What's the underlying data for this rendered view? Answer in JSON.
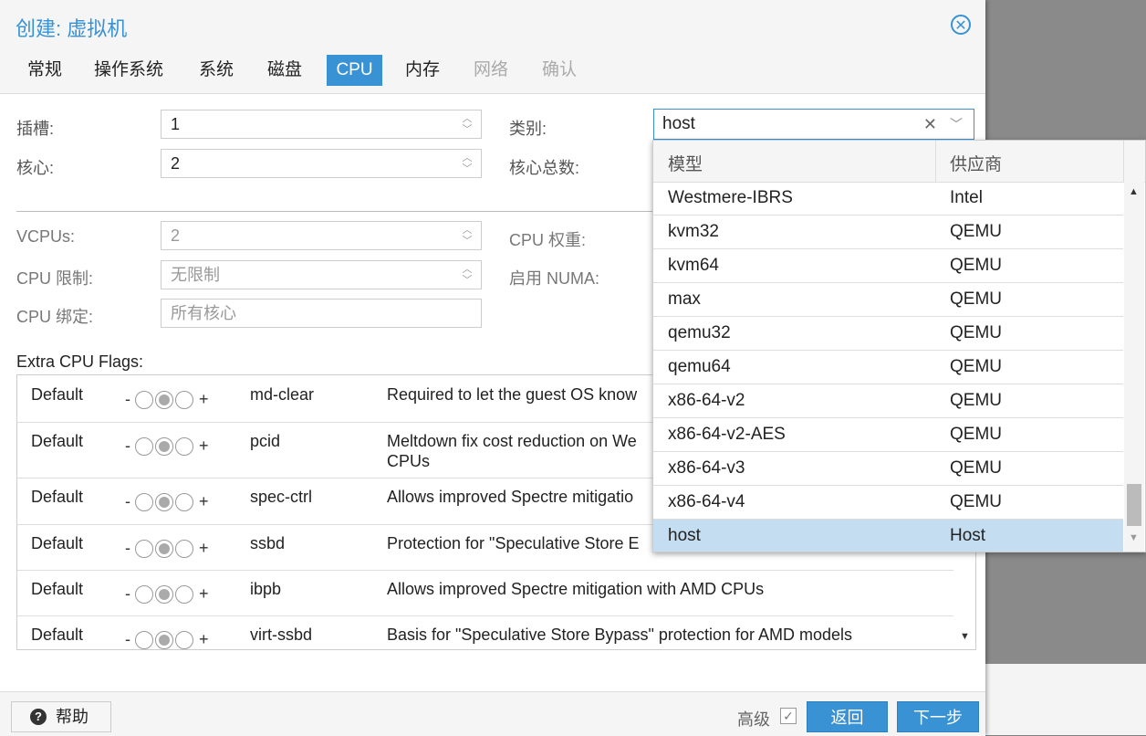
{
  "dialog": {
    "title": "创建: 虚拟机"
  },
  "tabs": [
    {
      "label": "常规",
      "state": "normal"
    },
    {
      "label": "操作系统",
      "state": "normal"
    },
    {
      "label": "系统",
      "state": "normal"
    },
    {
      "label": "磁盘",
      "state": "normal"
    },
    {
      "label": "CPU",
      "state": "active"
    },
    {
      "label": "内存",
      "state": "normal"
    },
    {
      "label": "网络",
      "state": "disabled"
    },
    {
      "label": "确认",
      "state": "disabled"
    }
  ],
  "form": {
    "sockets_label": "插槽:",
    "sockets_value": "1",
    "cores_label": "核心:",
    "cores_value": "2",
    "type_label": "类别:",
    "type_value": "host",
    "total_cores_label": "核心总数:",
    "vcpus_label": "VCPUs:",
    "vcpus_value": "2",
    "cpu_limit_label": "CPU 限制:",
    "cpu_limit_placeholder": "无限制",
    "cpu_affinity_label": "CPU 绑定:",
    "cpu_affinity_placeholder": "所有核心",
    "cpu_weight_label": "CPU 权重:",
    "numa_label": "启用 NUMA:"
  },
  "flags": {
    "label": "Extra CPU Flags:",
    "rows": [
      {
        "state": "Default",
        "name": "md-clear",
        "desc": "Required to let the guest OS know"
      },
      {
        "state": "Default",
        "name": "pcid",
        "desc": "Meltdown fix cost reduction on We",
        "desc2": "CPUs"
      },
      {
        "state": "Default",
        "name": "spec-ctrl",
        "desc": "Allows improved Spectre mitigatio"
      },
      {
        "state": "Default",
        "name": "ssbd",
        "desc": "Protection for \"Speculative Store E"
      },
      {
        "state": "Default",
        "name": "ibpb",
        "desc": "Allows improved Spectre mitigation with AMD CPUs"
      },
      {
        "state": "Default",
        "name": "virt-ssbd",
        "desc": "Basis for \"Speculative Store Bypass\" protection for AMD models"
      }
    ],
    "minus": "-",
    "plus": "+"
  },
  "dropdown": {
    "col_model": "模型",
    "col_vendor": "供应商",
    "rows": [
      {
        "model": "Westmere-IBRS",
        "vendor": "Intel"
      },
      {
        "model": "kvm32",
        "vendor": "QEMU"
      },
      {
        "model": "kvm64",
        "vendor": "QEMU"
      },
      {
        "model": "max",
        "vendor": "QEMU"
      },
      {
        "model": "qemu32",
        "vendor": "QEMU"
      },
      {
        "model": "qemu64",
        "vendor": "QEMU"
      },
      {
        "model": "x86-64-v2",
        "vendor": "QEMU"
      },
      {
        "model": "x86-64-v2-AES",
        "vendor": "QEMU"
      },
      {
        "model": "x86-64-v3",
        "vendor": "QEMU"
      },
      {
        "model": "x86-64-v4",
        "vendor": "QEMU"
      },
      {
        "model": "host",
        "vendor": "Host",
        "selected": true
      }
    ]
  },
  "footer": {
    "help_label": "帮助",
    "advanced_label": "高级",
    "back_label": "返回",
    "next_label": "下一步"
  },
  "colors": {
    "accent": "#3892d4",
    "selected_row": "#c5ddf1"
  }
}
